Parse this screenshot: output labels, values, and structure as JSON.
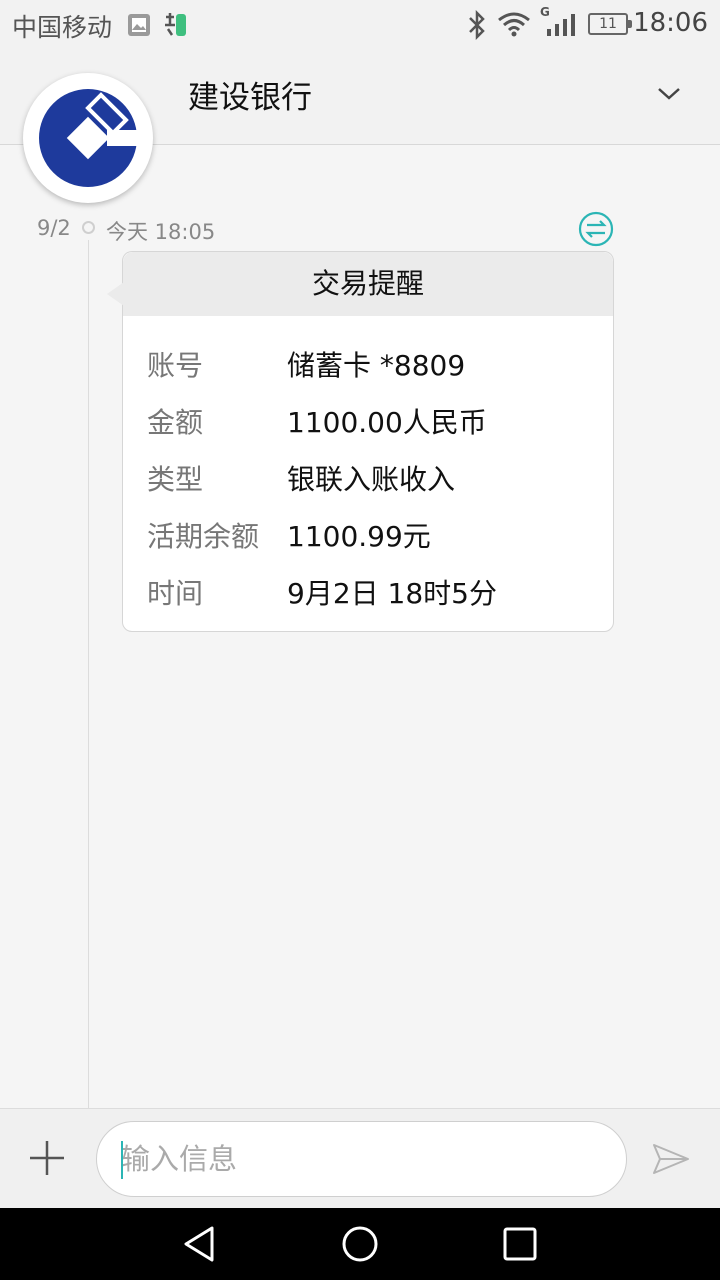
{
  "status_bar": {
    "carrier": "中国移动",
    "network": "G",
    "battery": "11",
    "time": "18:06"
  },
  "header": {
    "contact_name": "建设银行"
  },
  "thread": {
    "date": "9/2",
    "time": "今天 18:05"
  },
  "message": {
    "title": "交易提醒",
    "rows": [
      {
        "label": "账号",
        "value": "储蓄卡 *8809"
      },
      {
        "label": "金额",
        "value": "1100.00人民币"
      },
      {
        "label": "类型",
        "value": "银联入账收入"
      },
      {
        "label": "活期余额",
        "value": "1100.99元"
      },
      {
        "label": "时间",
        "value": "9月2日 18时5分"
      }
    ]
  },
  "composer": {
    "placeholder": "输入信息"
  },
  "colors": {
    "accent": "#2bb5b5",
    "bank_blue": "#1e3a9c"
  },
  "icons": [
    "image-icon",
    "app-notification-icon",
    "bluetooth-icon",
    "wifi-icon",
    "signal-icon",
    "battery-icon",
    "chevron-down-icon",
    "swap-icon",
    "plus-icon",
    "send-icon",
    "back-icon",
    "home-icon",
    "recents-icon"
  ]
}
